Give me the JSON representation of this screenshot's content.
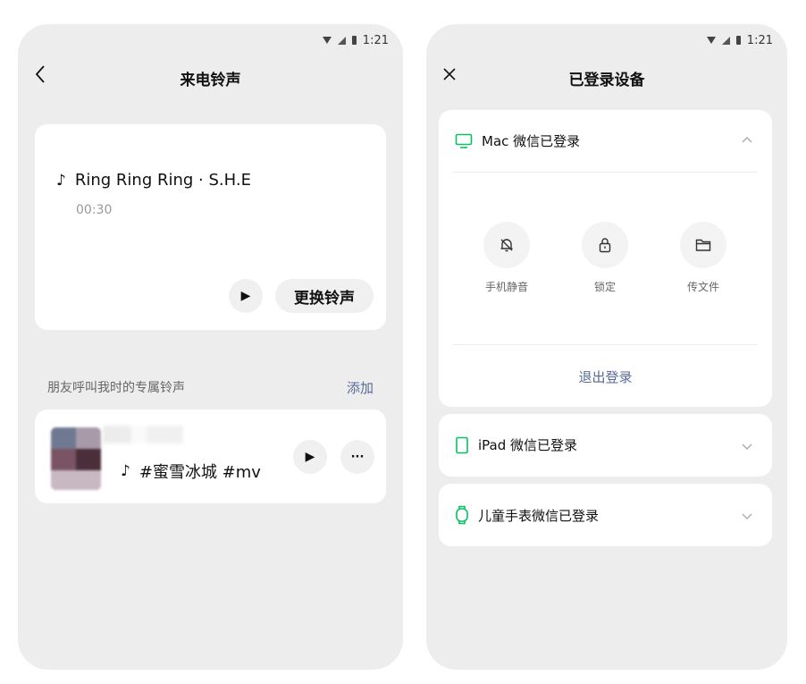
{
  "left_screen": {
    "status": {
      "time": "1:21"
    },
    "nav": {
      "title": "来电铃声",
      "back_icon": "chevron-left-icon"
    },
    "ringtone": {
      "song": "Ring Ring Ring · S.H.E",
      "duration": "00:30",
      "change_label": "更换铃声"
    },
    "friends_section": {
      "label": "朋友呼叫我时的专属铃声",
      "add_label": "添加"
    },
    "friend_item": {
      "song": "#蜜雪冰城 #mv",
      "more_label": "···"
    }
  },
  "right_screen": {
    "status": {
      "time": "1:21"
    },
    "nav": {
      "title": "已登录设备",
      "close_icon": "close-icon"
    },
    "devices": [
      {
        "label": "Mac 微信已登录",
        "icon": "monitor-icon",
        "expanded": true
      },
      {
        "label": "iPad 微信已登录",
        "icon": "tablet-icon",
        "expanded": false
      },
      {
        "label": "儿童手表微信已登录",
        "icon": "watch-icon",
        "expanded": false
      }
    ],
    "mac_actions": [
      {
        "label": "手机静音",
        "icon": "bell-off-icon"
      },
      {
        "label": "锁定",
        "icon": "lock-icon"
      },
      {
        "label": "传文件",
        "icon": "folder-icon"
      }
    ],
    "logout_label": "退出登录"
  },
  "colors": {
    "accent_green": "#07c160",
    "link_blue": "#576b95",
    "background": "#ededed"
  }
}
